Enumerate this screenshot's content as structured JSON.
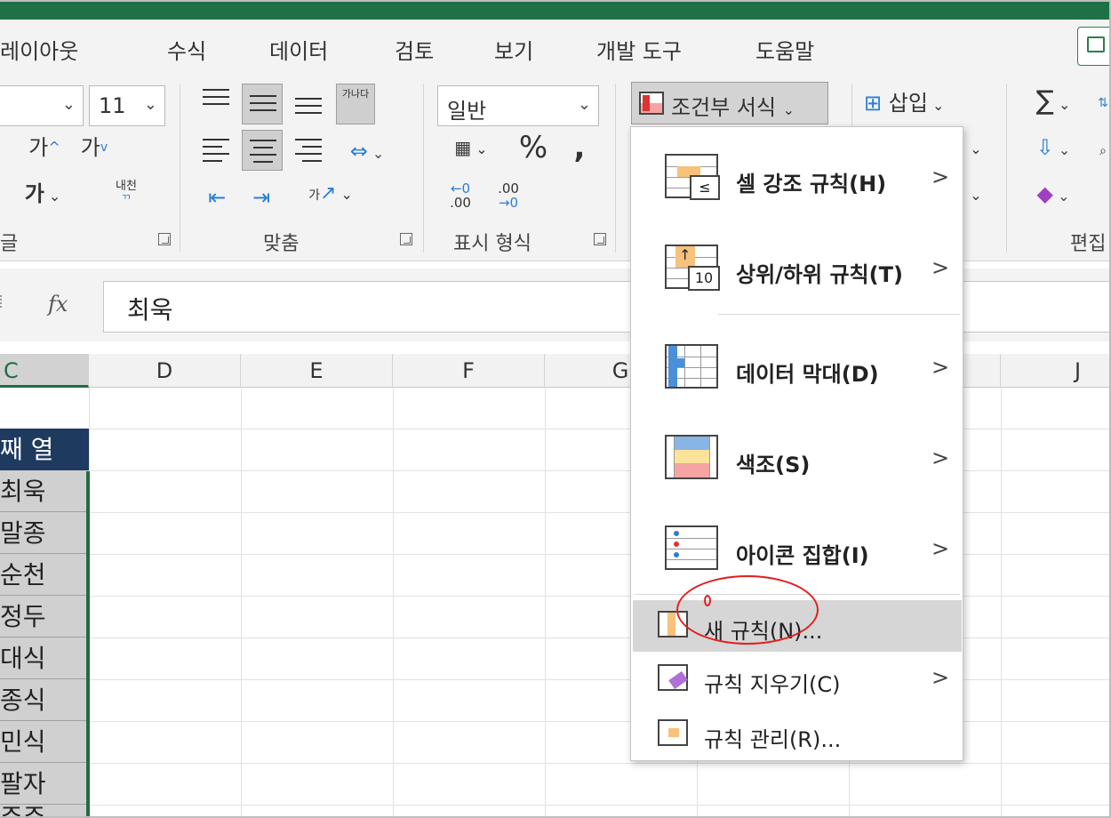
{
  "tabs": [
    "레이아웃",
    "수식",
    "데이터",
    "검토",
    "보기",
    "개발 도구",
    "도움말"
  ],
  "font": {
    "size": "11",
    "grow_label": "가",
    "shrink_label": "가",
    "bold_label": "가",
    "phonetic_label": "내천",
    "group_label": "글"
  },
  "alignment": {
    "wrap_icon_text": "가나다",
    "orient_label": "가",
    "group_label": "맞춤"
  },
  "number": {
    "format": "일반",
    "percent": "%",
    "comma": ",",
    "dec_inc_a": "←0",
    "dec_inc_b": ".00",
    "dec_dec_a": ".00",
    "dec_dec_b": "→0",
    "group_label": "표시 형식"
  },
  "styles": {
    "conditional_formatting": "조건부 서식"
  },
  "cells_group": {
    "insert": "삽입"
  },
  "editing": {
    "sum_symbol": "∑",
    "group_label": "편집"
  },
  "formula_bar": {
    "fx": "fx",
    "value": "최욱"
  },
  "columns": [
    "C",
    "D",
    "E",
    "F",
    "G",
    "J"
  ],
  "cells_c": [
    "째 열",
    "최욱",
    "말종",
    "순천",
    "정두",
    "대식",
    "종식",
    "민식",
    "팔자",
    "주주"
  ],
  "menu": {
    "items": [
      {
        "label": "셀 강조 규칙(H)",
        "has_submenu": true
      },
      {
        "label": "상위/하위 규칙(T)",
        "has_submenu": true,
        "icon_text": "10"
      },
      {
        "label": "데이터 막대(D)",
        "has_submenu": true
      },
      {
        "label": "색조(S)",
        "has_submenu": true
      },
      {
        "label": "아이콘 집합(I)",
        "has_submenu": true
      }
    ],
    "actions": [
      {
        "label": "새 규칙(N)...",
        "highlighted": true
      },
      {
        "label": "규칙 지우기(C)",
        "has_submenu": true
      },
      {
        "label": "규칙 관리(R)..."
      }
    ]
  },
  "colors": {
    "accent_green": "#1f6e43",
    "header_navy": "#1e3a5f",
    "annotation_red": "#e02020"
  }
}
